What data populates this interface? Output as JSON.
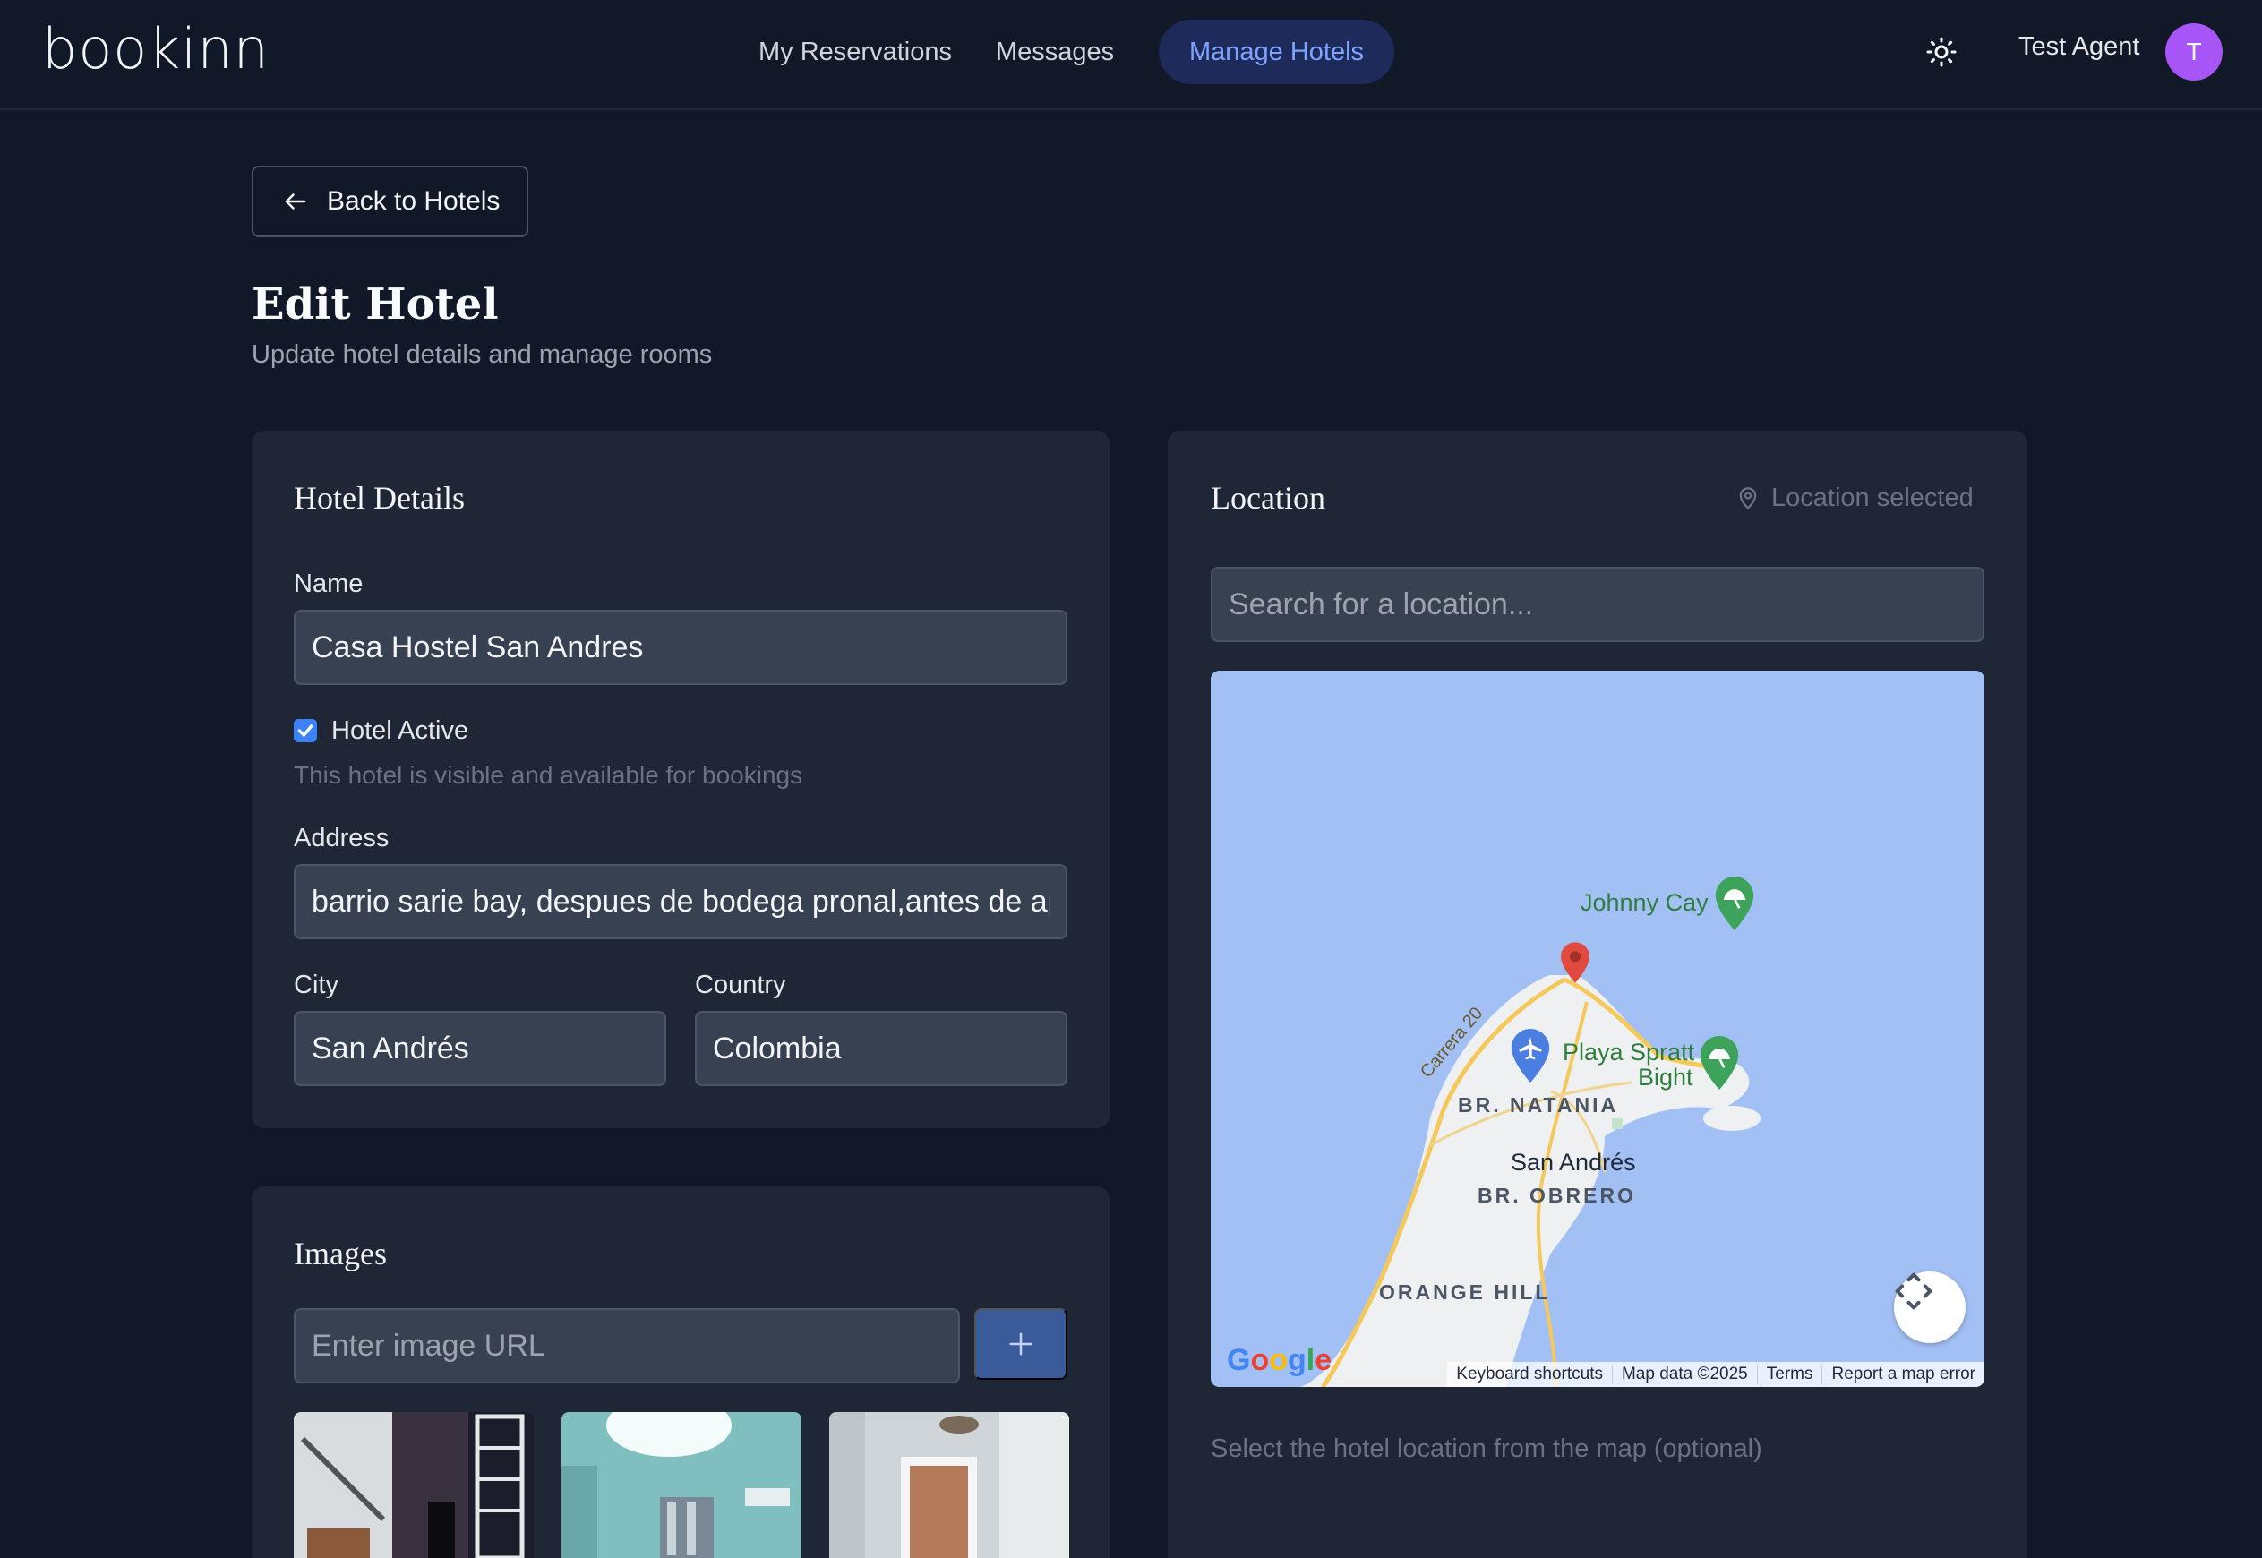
{
  "app": {
    "logo": "bookinn"
  },
  "nav": {
    "links": [
      "My Reservations",
      "Messages",
      "Manage Hotels"
    ],
    "active": "Manage Hotels"
  },
  "user": {
    "name": "Test Agent",
    "initial": "T"
  },
  "header": {
    "back_label": "Back to Hotels",
    "title": "Edit Hotel",
    "subtitle": "Update hotel details and manage rooms"
  },
  "details": {
    "title": "Hotel Details",
    "name_label": "Name",
    "name_value": "Casa Hostel San Andres",
    "active_label": "Hotel Active",
    "active_checked": true,
    "active_hint": "This hotel is visible and available for bookings",
    "address_label": "Address",
    "address_value": "barrio sarie bay, despues de bodega pronal,antes de ap",
    "city_label": "City",
    "city_value": "San Andrés",
    "country_label": "Country",
    "country_value": "Colombia"
  },
  "images": {
    "title": "Images",
    "url_placeholder": "Enter image URL"
  },
  "location": {
    "title": "Location",
    "status": "Location selected",
    "search_placeholder": "Search for a location...",
    "hint": "Select the hotel location from the map (optional)",
    "map": {
      "labels": {
        "johnny_cay": "Johnny Cay",
        "playa_spratt": "Playa Spratt",
        "bight": "Bight",
        "natania": "BR. NATANIA",
        "san_andres": "San Andrés",
        "obrero": "BR. OBRERO",
        "orange_hill": "ORANGE HILL",
        "carrera": "Carrera 20"
      },
      "footer": [
        "Keyboard shortcuts",
        "Map data ©2025",
        "Terms",
        "Report a map error"
      ],
      "google": "Google"
    }
  },
  "colors": {
    "accent": "#3b82f6",
    "active_nav_bg": "#1e2a5a",
    "avatar": "#a855f7",
    "water": "#a3c0f5",
    "land": "#eef0f2"
  }
}
